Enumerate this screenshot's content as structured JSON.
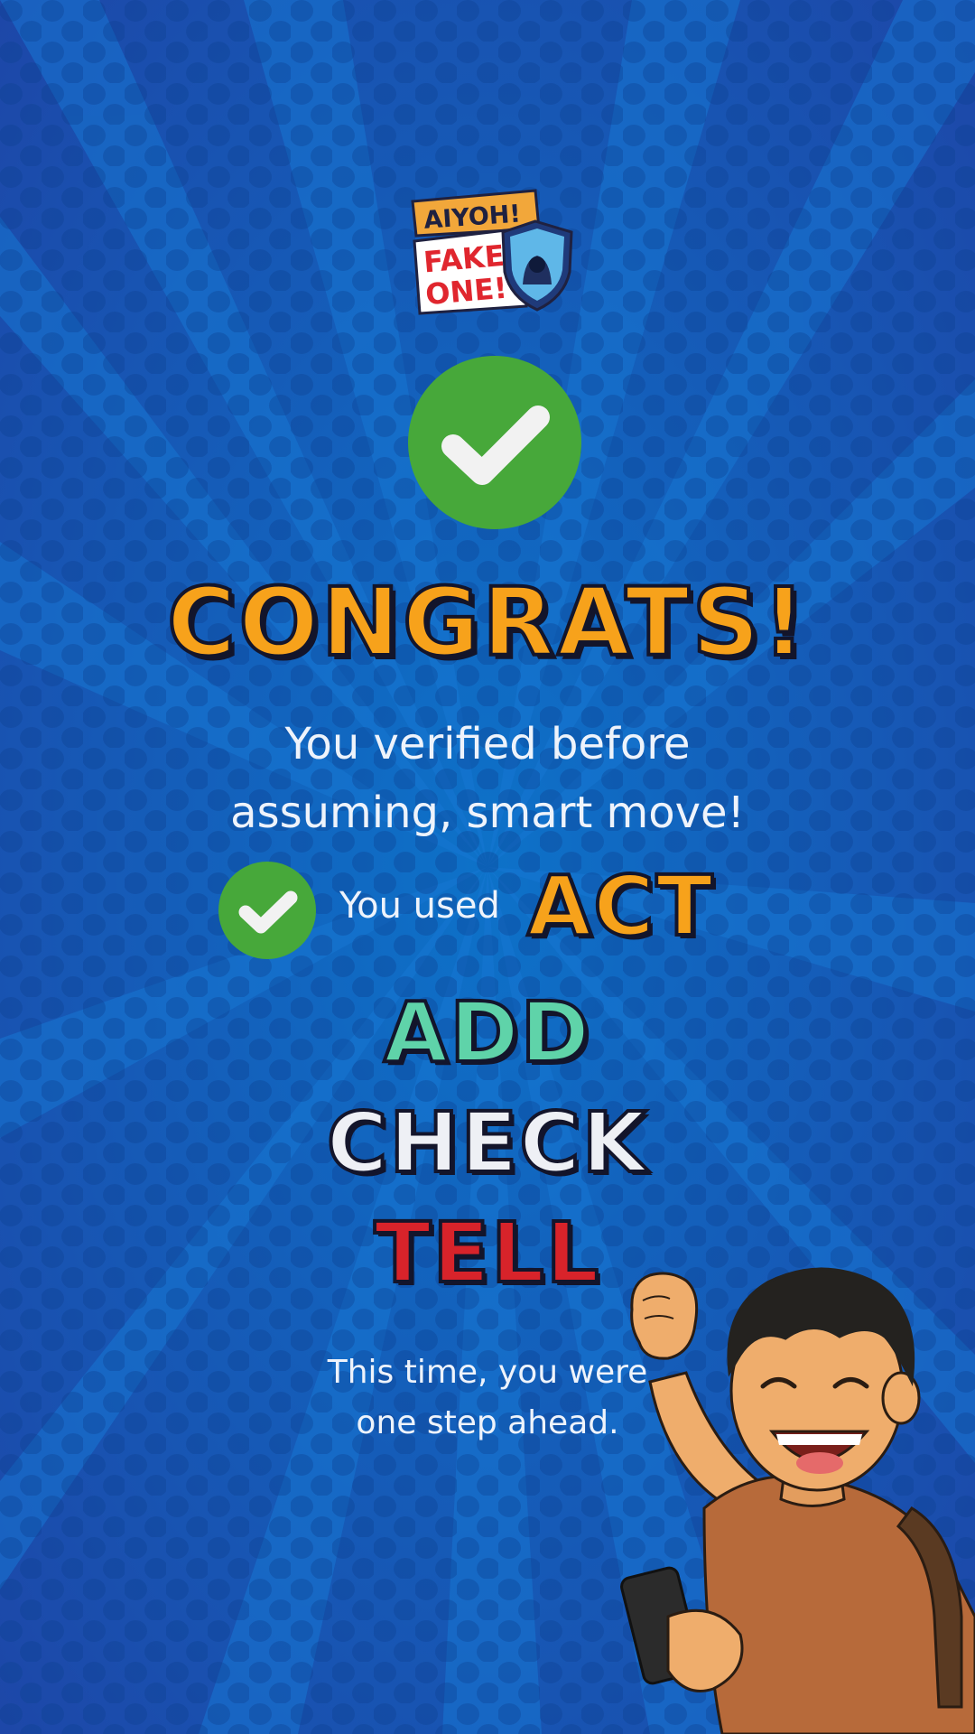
{
  "logo": {
    "line1": "AIYOH!",
    "line2": "FAKE",
    "line3": "ONE!",
    "icon": "hacker-shield-icon"
  },
  "status": {
    "icon": "check-circle-icon",
    "title": "CONGRATS!",
    "subtitle_line1": "You verified before",
    "subtitle_line2": "assuming, smart move!"
  },
  "method": {
    "prefix": "You used",
    "words": [
      "ACT",
      "ADD",
      "CHECK",
      "TELL"
    ]
  },
  "closing": {
    "line1": "This time, you were",
    "line2": "one step ahead."
  },
  "colors": {
    "background": "#0b62b8",
    "accent_orange": "#f7a21b",
    "accent_teal": "#5fd3a9",
    "accent_red": "#d8232a",
    "success_green": "#47a83a"
  }
}
